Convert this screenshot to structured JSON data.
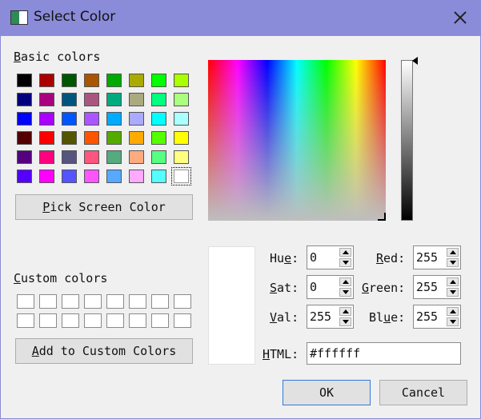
{
  "window": {
    "title": "Select Color"
  },
  "basic": {
    "label_first": "B",
    "label_rest": "asic colors"
  },
  "basic_colors": [
    [
      "#000000",
      "#aa0000",
      "#005500",
      "#aa5500",
      "#00aa00",
      "#aaaa00",
      "#00ff00",
      "#aaff00"
    ],
    [
      "#00007f",
      "#aa007f",
      "#00557f",
      "#aa557f",
      "#00aa7f",
      "#aaaa7f",
      "#00ff7f",
      "#aaff7f"
    ],
    [
      "#0000ff",
      "#aa00ff",
      "#0055ff",
      "#aa55ff",
      "#00aaff",
      "#aaaaff",
      "#00ffff",
      "#aaffff"
    ],
    [
      "#550000",
      "#ff0000",
      "#555500",
      "#ff5500",
      "#55aa00",
      "#ffaa00",
      "#55ff00",
      "#ffff00"
    ],
    [
      "#55007f",
      "#ff007f",
      "#55557f",
      "#ff557f",
      "#55aa7f",
      "#ffaa7f",
      "#55ff7f",
      "#ffff7f"
    ],
    [
      "#5500ff",
      "#ff00ff",
      "#5555ff",
      "#ff55ff",
      "#55aaff",
      "#ffaaff",
      "#55ffff",
      "#ffffff"
    ]
  ],
  "pick_button": {
    "first": "P",
    "rest": "ick Screen Color"
  },
  "custom": {
    "label_first": "C",
    "label_rest": "ustom colors"
  },
  "add_button": {
    "first": "A",
    "rest": "dd to Custom Colors"
  },
  "fields": {
    "hue": {
      "pre": "Hu",
      "ul": "e",
      "post": ":",
      "value": "0"
    },
    "sat": {
      "pre": "",
      "ul": "S",
      "post": "at:",
      "value": "0"
    },
    "val": {
      "pre": "",
      "ul": "V",
      "post": "al:",
      "value": "255"
    },
    "red": {
      "pre": "",
      "ul": "R",
      "post": "ed:",
      "value": "255"
    },
    "green": {
      "pre": "",
      "ul": "G",
      "post": "reen:",
      "value": "255"
    },
    "blue": {
      "pre": "Bl",
      "ul": "u",
      "post": "e:",
      "value": "255"
    },
    "html": {
      "pre": "",
      "ul": "H",
      "post": "TML:",
      "value": "#ffffff"
    }
  },
  "ok_label": "OK",
  "cancel_label": "Cancel",
  "selected_color": "#ffffff"
}
